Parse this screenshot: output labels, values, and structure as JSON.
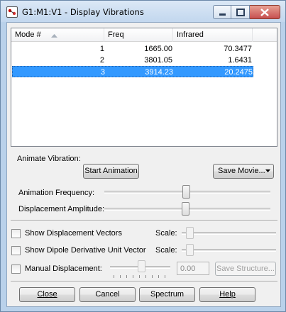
{
  "window": {
    "title": "G1:M1:V1 - Display Vibrations"
  },
  "table": {
    "columns": [
      "Mode #",
      "Freq",
      "Infrared"
    ],
    "rows": [
      {
        "mode": "1",
        "freq": "1665.00",
        "infrared": "70.3477",
        "selected": false
      },
      {
        "mode": "2",
        "freq": "3801.05",
        "infrared": "1.6431",
        "selected": false
      },
      {
        "mode": "3",
        "freq": "3914.23",
        "infrared": "20.2475",
        "selected": true
      }
    ]
  },
  "animate": {
    "group_label": "Animate Vibration:",
    "start_label": "Start Animation",
    "save_movie_label": "Save Movie...",
    "frequency_label": "Animation Frequency:",
    "frequency_level": 0.5,
    "amplitude_label": "Displacement Amplitude:",
    "amplitude_level": 0.5
  },
  "options": {
    "show_vectors_label": "Show Displacement Vectors",
    "show_dipole_label": "Show Dipole Derivative Unit Vector",
    "manual_label": "Manual Displacement:",
    "scale_label": "Scale:",
    "manual_value": "0.00",
    "save_structure_label": "Save Structure..."
  },
  "buttons": {
    "close": "Close",
    "cancel": "Cancel",
    "spectrum": "Spectrum",
    "help": "Help"
  },
  "colors": {
    "selection": "#3399ff",
    "frame": "#b9d1ea",
    "close_button": "#c75050"
  }
}
